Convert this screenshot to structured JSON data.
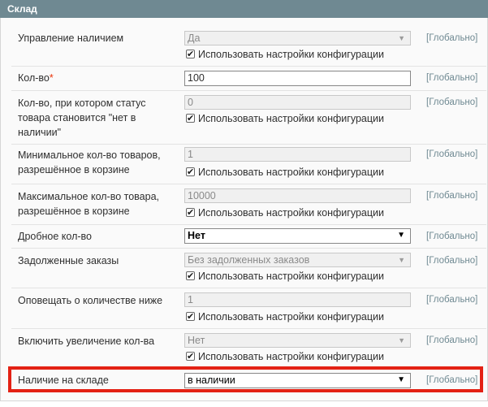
{
  "panel": {
    "title": "Склад"
  },
  "use_config_label": "Использовать настройки конфигурации",
  "fields": [
    {
      "label": "Управление наличием",
      "value": "Да",
      "scope": "[Глобально]"
    },
    {
      "label": "Кол-во",
      "value": "100",
      "scope": "[Глобально]",
      "required_mark": "*"
    },
    {
      "label": "Кол-во, при котором статус товара становится \"нет в наличии\"",
      "value": "0",
      "scope": "[Глобально]"
    },
    {
      "label": "Минимальное кол-во товаров, разрешённое в корзине",
      "value": "1",
      "scope": "[Глобально]"
    },
    {
      "label": "Максимальное кол-во товара, разрешённое в корзине",
      "value": "10000",
      "scope": "[Глобально]"
    },
    {
      "label": "Дробное кол-во",
      "value": "Нет",
      "scope": "[Глобально]"
    },
    {
      "label": "Задолженные заказы",
      "value": "Без задолженных заказов",
      "scope": "[Глобально]"
    },
    {
      "label": "Оповещать о количестве ниже",
      "value": "1",
      "scope": "[Глобально]"
    },
    {
      "label": "Включить увеличение кол-ва",
      "value": "Нет",
      "scope": "[Глобально]"
    },
    {
      "label": "Наличие на складе",
      "value": "в наличии",
      "scope": "[Глобально]"
    }
  ]
}
